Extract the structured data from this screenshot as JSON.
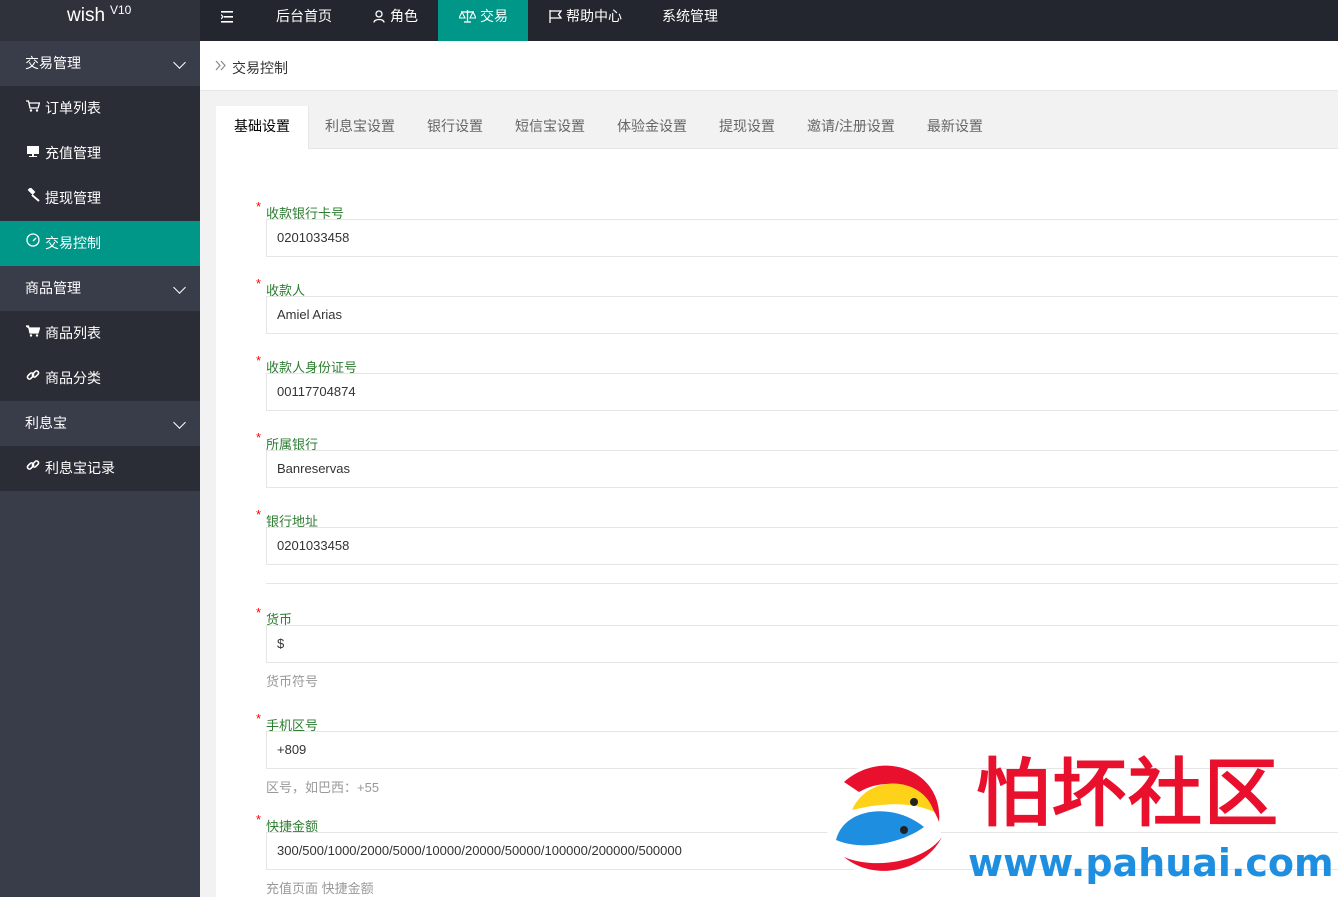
{
  "brand": {
    "name": "wish",
    "version": "V10"
  },
  "topnav": {
    "items": [
      {
        "label": "后台首页",
        "icon": ""
      },
      {
        "label": "角色",
        "icon": "user-icon"
      },
      {
        "label": "交易",
        "icon": "scale-icon"
      },
      {
        "label": "帮助中心",
        "icon": "flag-icon"
      },
      {
        "label": "系统管理",
        "icon": ""
      }
    ],
    "active": "交易",
    "accent": "#009688"
  },
  "sidebar": {
    "groups": [
      {
        "label": "交易管理",
        "items": [
          {
            "label": "订单列表",
            "icon": "cart-icon"
          },
          {
            "label": "充值管理",
            "icon": "screen-icon"
          },
          {
            "label": "提现管理",
            "icon": "hammer-icon"
          },
          {
            "label": "交易控制",
            "icon": "dashboard-icon"
          }
        ]
      },
      {
        "label": "商品管理",
        "items": [
          {
            "label": "商品列表",
            "icon": "cart-icon"
          },
          {
            "label": "商品分类",
            "icon": "link-icon"
          }
        ]
      },
      {
        "label": "利息宝",
        "items": [
          {
            "label": "利息宝记录",
            "icon": "link-icon"
          }
        ]
      }
    ],
    "active": "交易控制"
  },
  "breadcrumb": {
    "text": "交易控制"
  },
  "tabs": [
    "基础设置",
    "利息宝设置",
    "银行设置",
    "短信宝设置",
    "体验金设置",
    "提现设置",
    "邀请/注册设置",
    "最新设置"
  ],
  "active_tab": "基础设置",
  "form": {
    "required_mark": "*",
    "fields": [
      {
        "label": "收款银行卡号",
        "value": "0201033458",
        "hint": ""
      },
      {
        "label": "收款人",
        "value": "Amiel Arias",
        "hint": ""
      },
      {
        "label": "收款人身份证号",
        "value": "00117704874",
        "hint": ""
      },
      {
        "label": "所属银行",
        "value": "Banreservas",
        "hint": ""
      },
      {
        "label": "银行地址",
        "value": "0201033458",
        "hint": ""
      },
      {
        "label": "货币",
        "value": "$",
        "hint": "货币符号"
      },
      {
        "label": "手机区号",
        "value": "+809",
        "hint": "区号，如巴西：+55"
      },
      {
        "label": "快捷金额",
        "value": "300/500/1000/2000/5000/10000/20000/50000/100000/200000/500000",
        "hint": "充值页面 快捷金额"
      }
    ]
  },
  "watermark": {
    "title": "怕坏社区",
    "url": "www.pahuai.com"
  }
}
